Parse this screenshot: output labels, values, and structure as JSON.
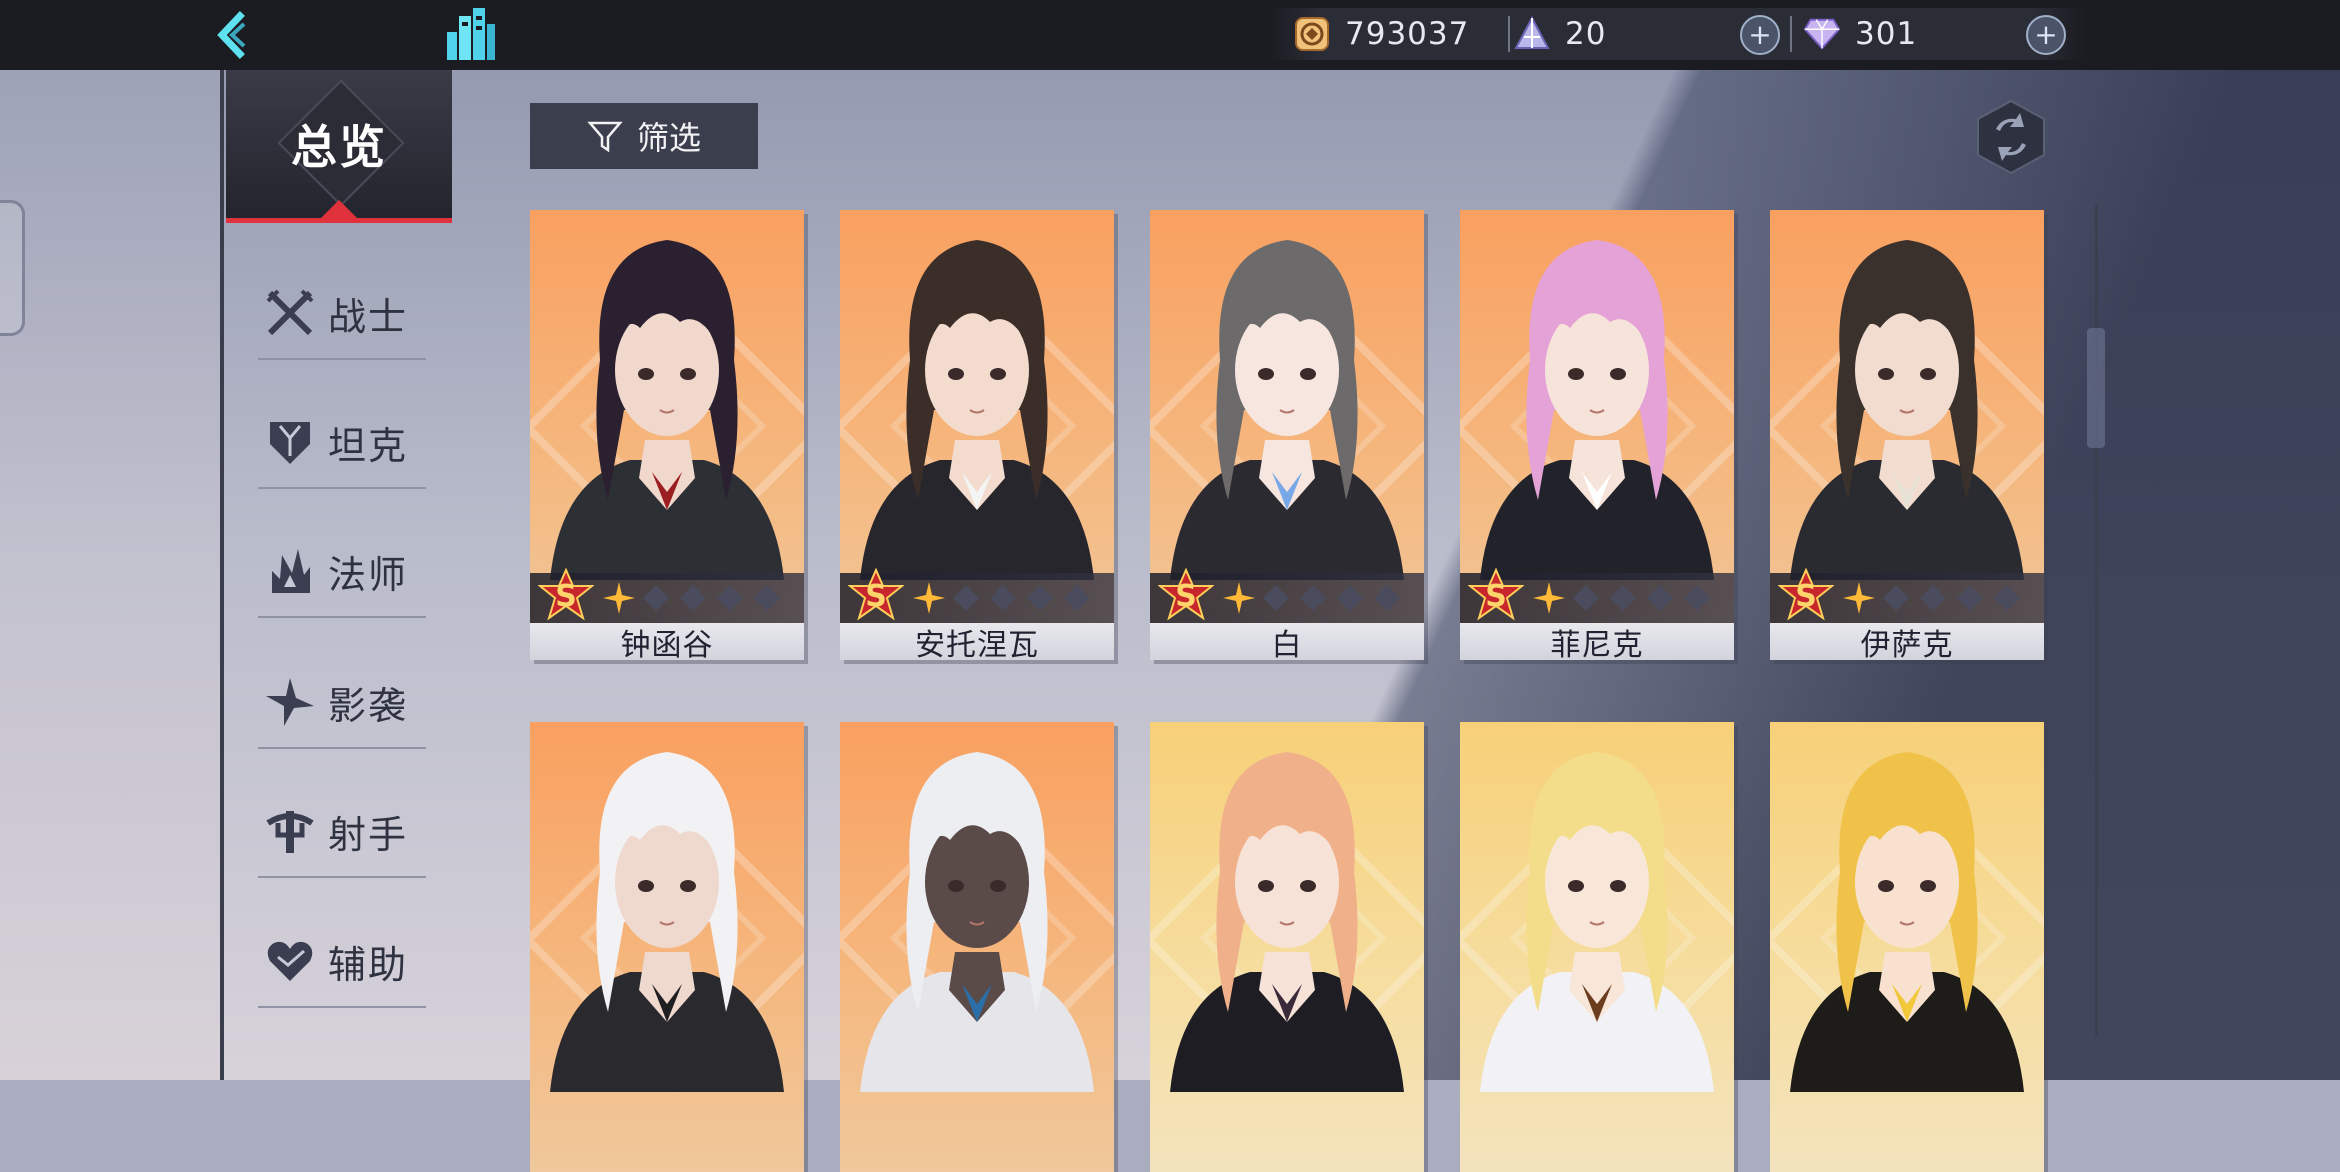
{
  "header": {
    "back_icon": "back-arrow-icon",
    "home_icon": "city-icon",
    "resources": {
      "gold": {
        "icon": "gold-coin-icon",
        "value": "793037"
      },
      "crystal": {
        "icon": "crystal-pyramid-icon",
        "value": "20"
      },
      "diamond": {
        "icon": "diamond-icon",
        "value": "301"
      }
    },
    "plus_label": "+"
  },
  "sidebar": {
    "active": {
      "label": "总览"
    },
    "items": [
      {
        "label": "战士",
        "icon": "crossed-swords-icon"
      },
      {
        "label": "坦克",
        "icon": "shield-icon"
      },
      {
        "label": "法师",
        "icon": "flame-icon"
      },
      {
        "label": "影袭",
        "icon": "shuriken-icon"
      },
      {
        "label": "射手",
        "icon": "crossbow-icon"
      },
      {
        "label": "辅助",
        "icon": "heart-icon"
      }
    ]
  },
  "toolbar": {
    "filter_label": "筛选",
    "filter_icon": "funnel-icon",
    "refresh_icon": "refresh-icon"
  },
  "characters": [
    {
      "name": "钟函谷",
      "rank": "S",
      "stars": 1,
      "theme": "orange",
      "hair": "#2a2030",
      "skin": "#f1d8cc",
      "outfit": "#2c2f34",
      "accent": "#9b1f22"
    },
    {
      "name": "安托涅瓦",
      "rank": "S",
      "stars": 1,
      "theme": "orange",
      "hair": "#3b2e28",
      "skin": "#f3dccd",
      "outfit": "#26262c",
      "accent": "#f4f4f4"
    },
    {
      "name": "白",
      "rank": "S",
      "stars": 1,
      "theme": "orange",
      "hair": "#6d6a6c",
      "skin": "#f7e6df",
      "outfit": "#2a2a30",
      "accent": "#78a8e8"
    },
    {
      "name": "菲尼克",
      "rank": "S",
      "stars": 1,
      "theme": "orange",
      "hair": "#e4a2d6",
      "skin": "#f6e3da",
      "outfit": "#22232a",
      "accent": "#ffffff"
    },
    {
      "name": "伊萨克",
      "rank": "S",
      "stars": 1,
      "theme": "orange",
      "hair": "#3a302c",
      "skin": "#f1dccf",
      "outfit": "#2a2b30",
      "accent": "#e8e2d6"
    },
    {
      "name": "",
      "rank": "",
      "stars": 0,
      "theme": "orange",
      "hair": "#f2f2f4",
      "skin": "#efd9cf",
      "outfit": "#2a2a2e",
      "accent": "#1f1f22"
    },
    {
      "name": "",
      "rank": "",
      "stars": 0,
      "theme": "orange",
      "hair": "#eceef2",
      "skin": "#5a4a48",
      "outfit": "#e6e6ea",
      "accent": "#2c6fa8"
    },
    {
      "name": "",
      "rank": "",
      "stars": 0,
      "theme": "gold",
      "hair": "#f0b08a",
      "skin": "#f6e2d6",
      "outfit": "#1e1d24",
      "accent": "#3a2a3a"
    },
    {
      "name": "",
      "rank": "",
      "stars": 0,
      "theme": "gold",
      "hair": "#f4dd8a",
      "skin": "#f8e7d8",
      "outfit": "#f2f2f6",
      "accent": "#6b3d1f"
    },
    {
      "name": "",
      "rank": "",
      "stars": 0,
      "theme": "gold",
      "hair": "#f1c24a",
      "skin": "#f8e2cf",
      "outfit": "#1e1c18",
      "accent": "#f2c73a"
    }
  ],
  "colors": {
    "accent_red": "#e0323c",
    "nav_dark": "#23242d",
    "card_orange": "#f9a060",
    "card_gold": "#f7d078"
  }
}
